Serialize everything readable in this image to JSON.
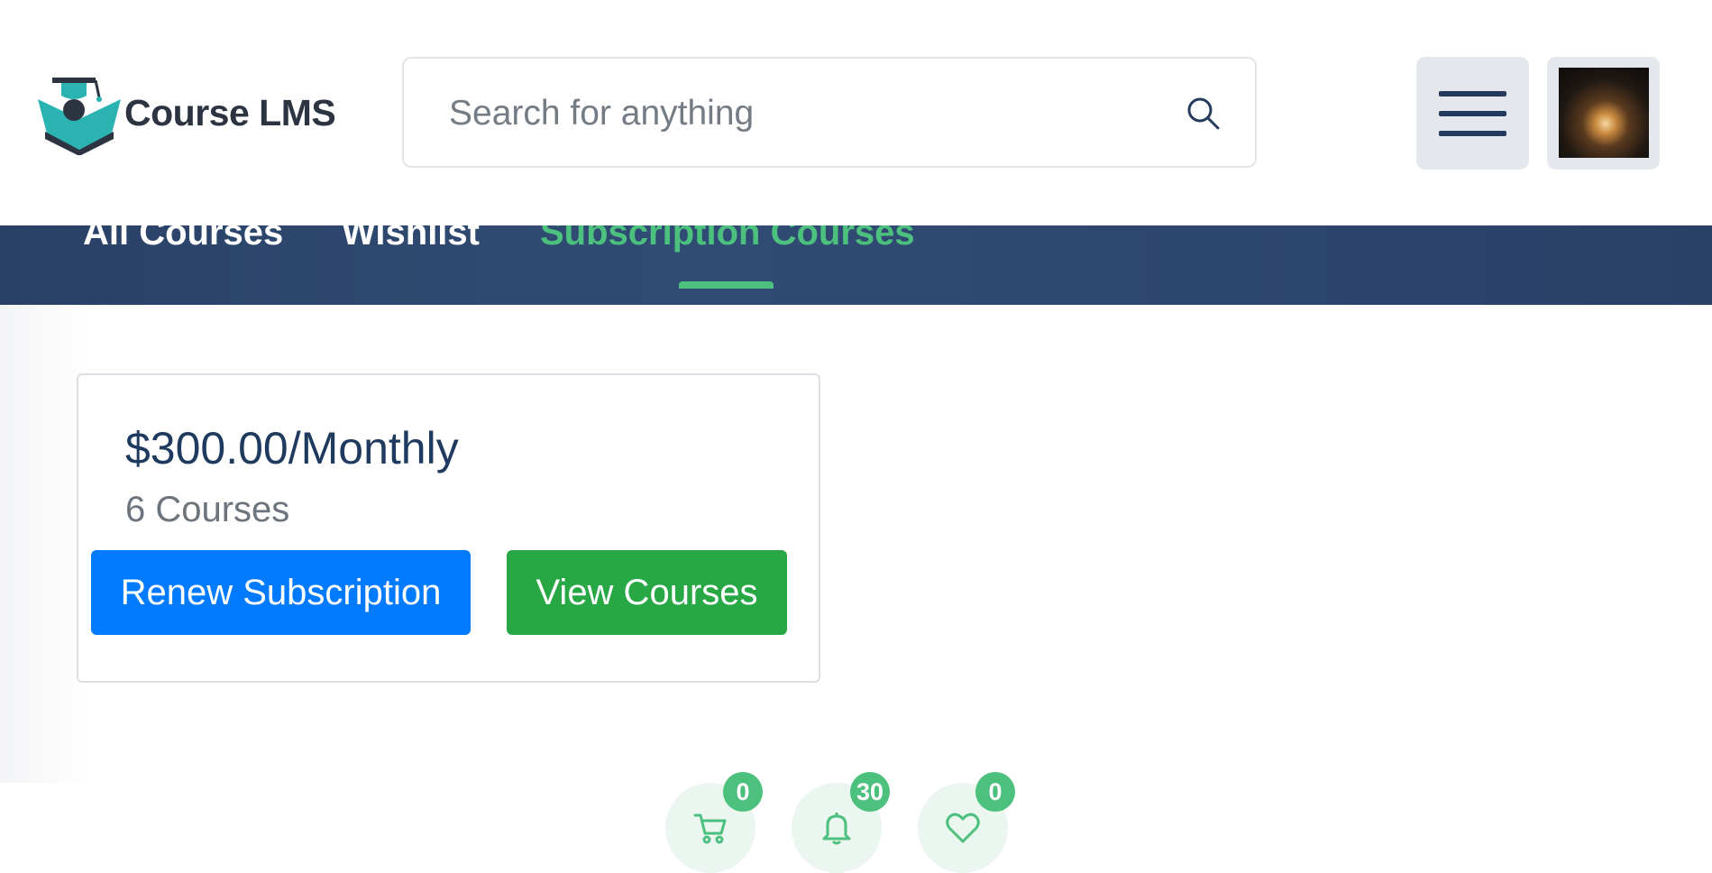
{
  "brand": {
    "name": "Course LMS",
    "logo_icon": "graduation-cap-book-icon",
    "colors": {
      "teal": "#2bb3b1",
      "dark": "#2c3341"
    }
  },
  "search": {
    "placeholder": "Search for anything",
    "value": "",
    "icon": "search-icon"
  },
  "header_actions": {
    "menu_icon": "hamburger-menu-icon",
    "avatar_icon": "user-avatar"
  },
  "tabs": [
    {
      "label": "All Courses",
      "active": false
    },
    {
      "label": "Wishlist",
      "active": false
    },
    {
      "label": "Subscription Courses",
      "active": true
    }
  ],
  "subscription_card": {
    "price": "$300.00/Monthly",
    "courses": "6 Courses",
    "renew_label": "Renew Subscription",
    "view_label": "View Courses"
  },
  "dock": [
    {
      "icon": "cart-icon",
      "badge": "0"
    },
    {
      "icon": "bell-icon",
      "badge": "30"
    },
    {
      "icon": "heart-icon",
      "badge": "0"
    }
  ],
  "colors": {
    "accent_green": "#4cc07d",
    "navy": "#2a4166",
    "primary_blue": "#007bff",
    "success_green": "#28a745"
  }
}
